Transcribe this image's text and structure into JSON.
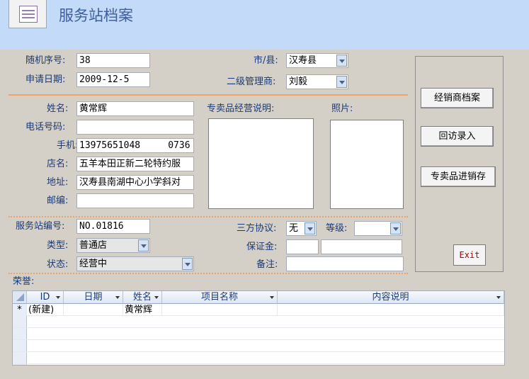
{
  "header": {
    "title": "服务站档案",
    "icon": "form-icon"
  },
  "top": {
    "serial": {
      "label": "随机序号:",
      "value": "38"
    },
    "apply_date": {
      "label": "申请日期:",
      "value": "2009-12-5"
    },
    "city": {
      "label": "市/县:",
      "value": "汉寿县"
    },
    "manager": {
      "label": "二级管理商:",
      "value": "刘毅"
    }
  },
  "contact": {
    "name": {
      "label": "姓名:",
      "value": "黄常辉"
    },
    "phone": {
      "label": "电话号码:",
      "value": ""
    },
    "mobile": {
      "label": "手机:",
      "value": "13975651048     0736"
    },
    "shop": {
      "label": "店名:",
      "value": "五羊本田正新二轮特约服"
    },
    "address": {
      "label": "地址:",
      "value": "汉寿县南湖中心小学斜对"
    },
    "postcode": {
      "label": "邮编:",
      "value": ""
    },
    "specialty_label": "专卖品经营说明:",
    "photo_label": "照片:"
  },
  "station": {
    "number": {
      "label": "服务站编号:",
      "value": "NO.01816"
    },
    "type": {
      "label": "类型:",
      "value": "普通店"
    },
    "status": {
      "label": "状态:",
      "value": "经营中"
    },
    "tripartite": {
      "label": "三方协议:",
      "value": "无"
    },
    "grade": {
      "label": "等级:",
      "value": ""
    },
    "deposit": {
      "label": "保证金:",
      "value": "",
      "value2": ""
    },
    "remark": {
      "label": "备注:",
      "value": ""
    }
  },
  "buttons": {
    "dealer": "经销商档案",
    "revisit": "回访录入",
    "inventory": "专卖品进销存",
    "exit": "Exit"
  },
  "honors": {
    "label": "荣誉:",
    "columns": [
      "ID",
      "日期",
      "姓名",
      "项目名称",
      "内容说明"
    ],
    "new_row": {
      "marker": "*",
      "id": "(新建)",
      "date": "",
      "name": "黄常辉",
      "project": "",
      "desc": ""
    }
  },
  "colors": {
    "header_bg": "#c3daf9",
    "separator": "#f0a46a",
    "label": "#1a3a78",
    "exit_text": "#b00000"
  }
}
